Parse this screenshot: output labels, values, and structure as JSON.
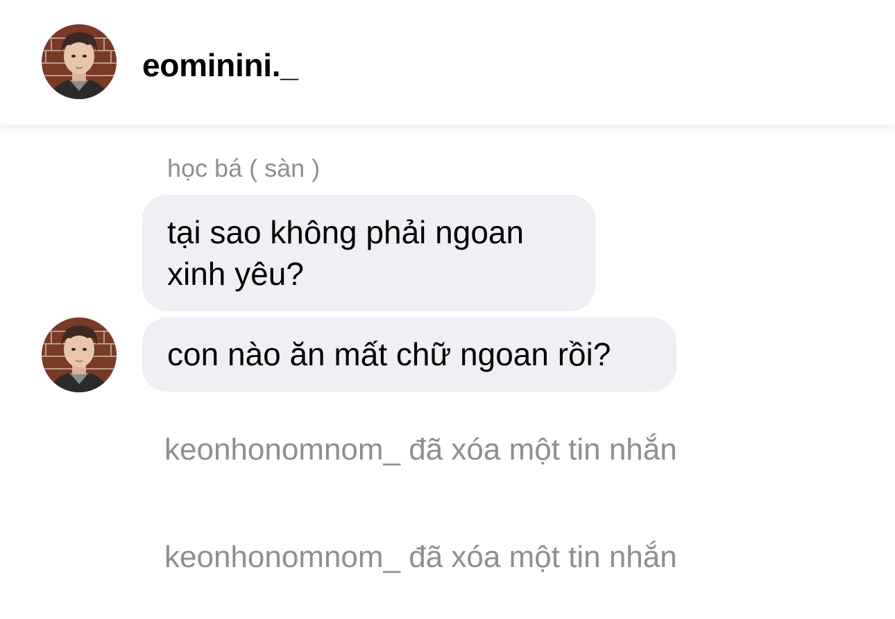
{
  "header": {
    "username": "eominini._",
    "avatar_icon": "profile-photo"
  },
  "thread": {
    "reply_label": "học bá ( sàn )",
    "messages": [
      {
        "text_lines": [
          "tại sao không phải ngoan",
          "xinh yêu?"
        ]
      },
      {
        "text": "con nào ăn mất chữ ngoan rồi?"
      }
    ],
    "system_notices": [
      "keonhonomnom_ đã xóa một tin nhắn",
      "keonhonomnom_ đã xóa một tin nhắn"
    ]
  },
  "colors": {
    "bubble_bg": "#efeff4",
    "secondary_text": "#8e8e93",
    "primary_text": "#000000"
  }
}
